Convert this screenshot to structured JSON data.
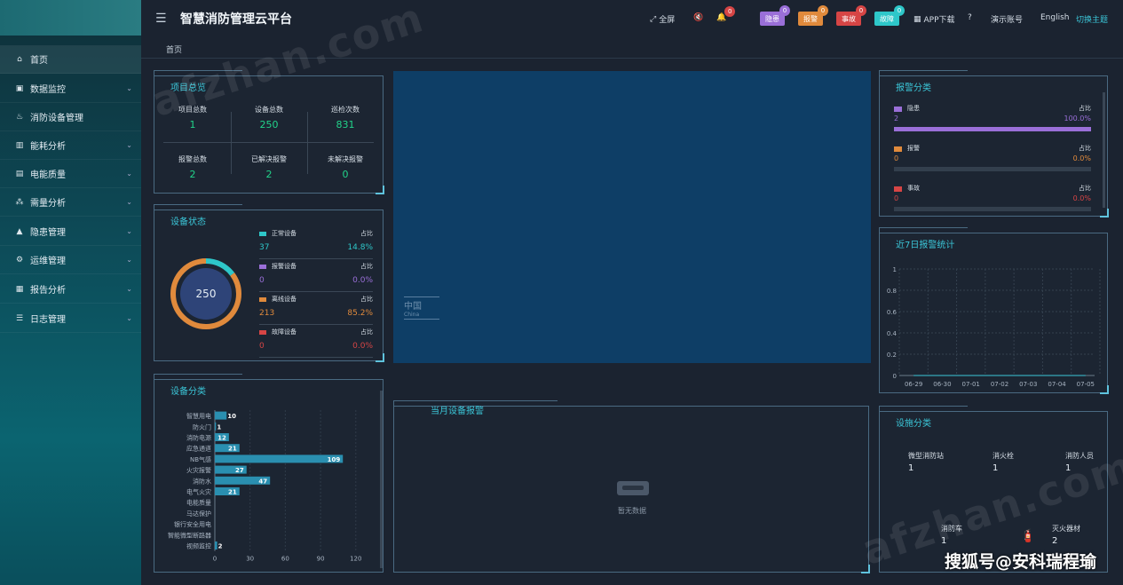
{
  "app": {
    "title": "智慧消防管理云平台"
  },
  "sidebar": {
    "items": [
      {
        "label": "首页",
        "icon": "home-icon",
        "chevron": false
      },
      {
        "label": "数据监控",
        "icon": "monitor-icon",
        "chevron": true
      },
      {
        "label": "消防设备管理",
        "icon": "extinguisher-icon",
        "chevron": false
      },
      {
        "label": "能耗分析",
        "icon": "bar-chart-icon",
        "chevron": true
      },
      {
        "label": "电能质量",
        "icon": "calendar-icon",
        "chevron": true
      },
      {
        "label": "需量分析",
        "icon": "nodes-icon",
        "chevron": true
      },
      {
        "label": "隐患管理",
        "icon": "warning-icon",
        "chevron": true
      },
      {
        "label": "运维管理",
        "icon": "gear-icon",
        "chevron": true
      },
      {
        "label": "报告分析",
        "icon": "report-icon",
        "chevron": true
      },
      {
        "label": "日志管理",
        "icon": "log-icon",
        "chevron": true
      }
    ]
  },
  "topbar": {
    "fullscreen": "全屏",
    "notify_count": "0",
    "tags": [
      {
        "label": "隐患",
        "count": "0",
        "color": "#9a6fd8",
        "badge": "#9a6fd8"
      },
      {
        "label": "报警",
        "count": "0",
        "color": "#e08a3c",
        "badge": "#e08a3c"
      },
      {
        "label": "事故",
        "count": "0",
        "color": "#d64545",
        "badge": "#d64545"
      },
      {
        "label": "故障",
        "count": "0",
        "color": "#2ec7c9",
        "badge": "#2ec7c9"
      }
    ],
    "app_download": "APP下载",
    "account": "演示账号",
    "language": "English",
    "theme": "切换主题"
  },
  "breadcrumb": "首页",
  "overview": {
    "title": "项目总览",
    "stats": [
      {
        "label": "项目总数",
        "value": "1"
      },
      {
        "label": "设备总数",
        "value": "250"
      },
      {
        "label": "巡检次数",
        "value": "831"
      },
      {
        "label": "报警总数",
        "value": "2"
      },
      {
        "label": "已解决报警",
        "value": "2"
      },
      {
        "label": "未解决报警",
        "value": "0"
      }
    ]
  },
  "device_status": {
    "title": "设备状态",
    "total": "250",
    "ratio_label": "占比",
    "rows": [
      {
        "name": "正常设备",
        "count": "37",
        "pct": "14.8%",
        "color": "#2ec7c9",
        "fraction": 0.148
      },
      {
        "name": "报警设备",
        "count": "0",
        "pct": "0.0%",
        "color": "#9a6fd8",
        "fraction": 0
      },
      {
        "name": "离线设备",
        "count": "213",
        "pct": "85.2%",
        "color": "#e08a3c",
        "fraction": 0.852
      },
      {
        "name": "故障设备",
        "count": "0",
        "pct": "0.0%",
        "color": "#d64545",
        "fraction": 0
      }
    ]
  },
  "map": {
    "label_cn": "中国",
    "label_en": "China"
  },
  "alarm_category": {
    "title": "报警分类",
    "ratio_label": "占比",
    "rows": [
      {
        "name": "隐患",
        "count": "2",
        "pct": "100.0%",
        "color": "#9a6fd8",
        "fraction": 1
      },
      {
        "name": "报警",
        "count": "0",
        "pct": "0.0%",
        "color": "#e08a3c",
        "fraction": 0
      },
      {
        "name": "事故",
        "count": "0",
        "pct": "0.0%",
        "color": "#d64545",
        "fraction": 0
      }
    ]
  },
  "weekly_alarm": {
    "title": "近7日报警统计"
  },
  "device_category": {
    "title": "设备分类"
  },
  "monthly_alarm": {
    "title": "当月设备报警",
    "empty": "暂无数据"
  },
  "facility": {
    "title": "设施分类",
    "items": [
      {
        "label": "微型消防站",
        "value": "1"
      },
      {
        "label": "消火栓",
        "value": "1"
      },
      {
        "label": "消防人员",
        "value": "1"
      },
      {
        "label": "消防车",
        "value": "1"
      },
      {
        "label": "灭火器材",
        "value": "2"
      }
    ]
  },
  "watermark": "搜狐号@安科瑞程瑜",
  "chart_data": [
    {
      "type": "bar",
      "orientation": "horizontal",
      "categories": [
        "智慧用电",
        "防火门",
        "消防电源",
        "应急通道",
        "NB气感",
        "火灾报警",
        "消防水",
        "电气火灾",
        "电能质量",
        "马达保护",
        "银行安全用电",
        "智能微型断路器",
        "视频监控"
      ],
      "values": [
        10,
        1,
        12,
        21,
        109,
        27,
        47,
        21,
        0,
        0,
        0,
        0,
        2
      ],
      "xlim": [
        0,
        130
      ],
      "xticks": [
        0,
        30,
        60,
        90,
        120
      ],
      "color": "#2a8fb0"
    },
    {
      "type": "line",
      "title": "近7日报警统计",
      "x": [
        "06-29",
        "06-30",
        "07-01",
        "07-02",
        "07-03",
        "07-04",
        "07-05"
      ],
      "series": [
        {
          "values": [
            0,
            0,
            0,
            0,
            0,
            0,
            0
          ]
        }
      ],
      "ylim": [
        0,
        1
      ],
      "yticks": [
        0,
        0.2,
        0.4,
        0.6,
        0.8,
        1
      ],
      "grid": true
    }
  ]
}
